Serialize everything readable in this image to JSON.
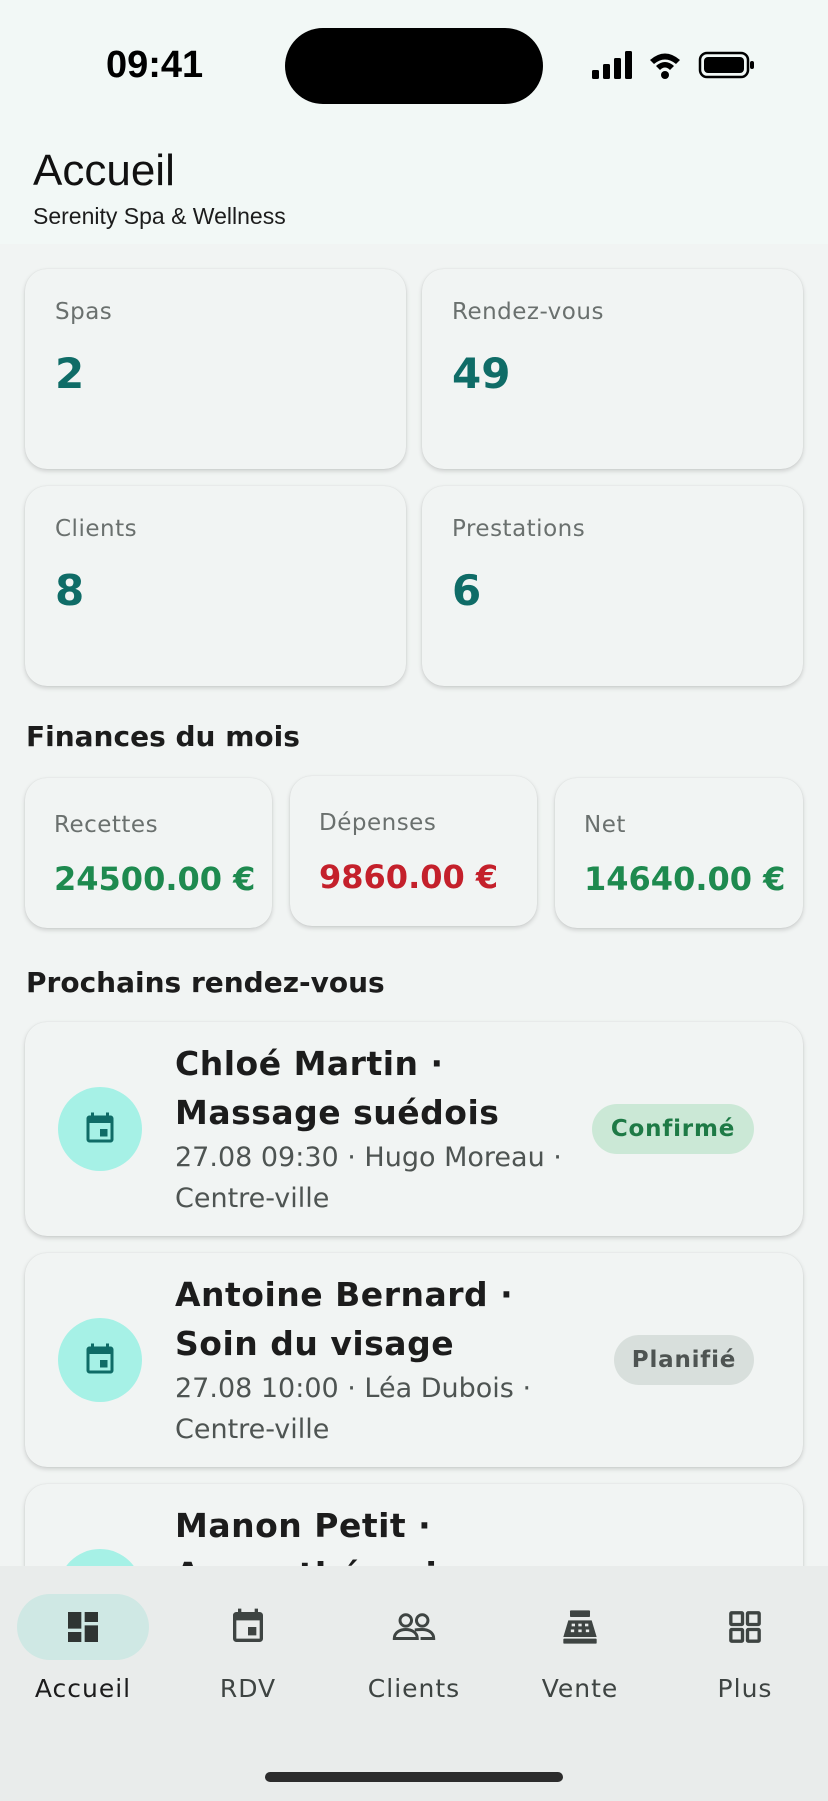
{
  "status_bar": {
    "time": "09:41"
  },
  "header": {
    "title": "Accueil",
    "subtitle": "Serenity Spa & Wellness"
  },
  "stats": [
    {
      "label": "Spas",
      "value": "2"
    },
    {
      "label": "Rendez-vous",
      "value": "49"
    },
    {
      "label": "Clients",
      "value": "8"
    },
    {
      "label": "Prestations",
      "value": "6"
    }
  ],
  "finances": {
    "title": "Finances du mois",
    "items": [
      {
        "label": "Recettes",
        "value": "24500.00 €",
        "color": "#1e8a4f"
      },
      {
        "label": "Dépenses",
        "value": "9860.00 €",
        "color": "#c4202b"
      },
      {
        "label": "Net",
        "value": "14640.00 €",
        "color": "#1e8a4f"
      }
    ]
  },
  "appointments": {
    "title": "Prochains rendez-vous",
    "items": [
      {
        "title": "Chloé Martin · Massage suédois",
        "meta": "27.08 09:30 · Hugo Moreau · Centre-ville",
        "status": "Confirmé"
      },
      {
        "title": "Antoine Bernard · Soin du visage",
        "meta": "27.08 10:00 · Léa Dubois · Centre-ville",
        "status": "Planifié"
      },
      {
        "title": "Manon Petit · Aromathérapie",
        "meta": "",
        "status": ""
      }
    ]
  },
  "nav": [
    {
      "label": "Accueil",
      "icon": "dashboard-icon",
      "active": true
    },
    {
      "label": "RDV",
      "icon": "calendar-icon",
      "active": false
    },
    {
      "label": "Clients",
      "icon": "people-icon",
      "active": false
    },
    {
      "label": "Vente",
      "icon": "cash-register-icon",
      "active": false
    },
    {
      "label": "Plus",
      "icon": "apps-grid-icon",
      "active": false
    }
  ],
  "colors": {
    "accent": "#0f6c67",
    "nav_active_bg": "#cfe8e4",
    "icon_circle": "#a6f1e6",
    "badge_confirmed_bg": "#cbe8d6",
    "badge_confirmed_text": "#1e7a46",
    "badge_planned_bg": "#d8dfdc",
    "badge_planned_text": "#4e5452"
  }
}
